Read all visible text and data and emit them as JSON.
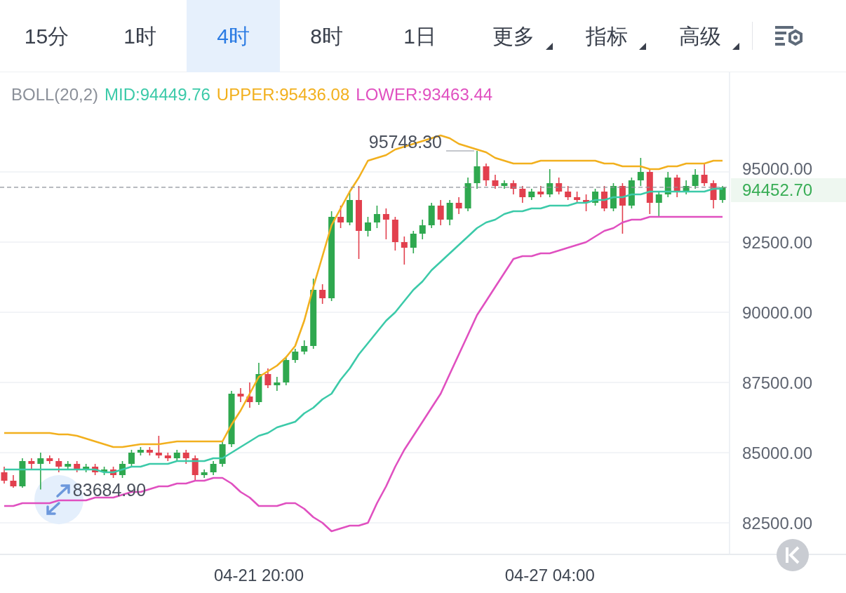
{
  "tabs": [
    {
      "label": "15分",
      "kind": "period",
      "selected": false
    },
    {
      "label": "1时",
      "kind": "period",
      "selected": false
    },
    {
      "label": "4时",
      "kind": "period",
      "selected": true
    },
    {
      "label": "8时",
      "kind": "period",
      "selected": false
    },
    {
      "label": "1日",
      "kind": "period",
      "selected": false
    },
    {
      "label": "更多",
      "kind": "dropdown",
      "selected": false
    },
    {
      "label": "指标",
      "kind": "dropdown",
      "selected": false
    },
    {
      "label": "高级",
      "kind": "dropdown",
      "selected": false
    }
  ],
  "indicator_legend": [
    {
      "text": "BOLL(20,2)",
      "color": "#8b9099"
    },
    {
      "text": "MID:94449.76",
      "color": "#3ccaa9"
    },
    {
      "text": "UPPER:95436.08",
      "color": "#f2b01e"
    },
    {
      "text": "LOWER:93463.44",
      "color": "#e050c0"
    }
  ],
  "chart": {
    "chart_data": {
      "type": "candlestick",
      "categories": [
        null,
        null,
        null,
        null,
        null,
        null,
        null,
        null,
        null,
        null,
        null,
        null,
        null,
        null,
        null,
        null,
        null,
        null,
        null,
        null,
        null,
        null,
        null,
        null,
        null,
        null,
        null,
        null,
        "04-21 20:00",
        null,
        null,
        null,
        null,
        null,
        null,
        null,
        null,
        null,
        null,
        null,
        null,
        null,
        null,
        null,
        null,
        null,
        null,
        null,
        null,
        null,
        null,
        null,
        null,
        null,
        null,
        null,
        null,
        null,
        null,
        null,
        "04-27 04:00",
        null,
        null,
        null,
        null,
        null,
        null,
        null,
        null,
        null,
        null,
        null,
        null,
        null,
        null,
        null,
        null,
        null,
        null,
        null
      ],
      "ohlc": [
        [
          84300,
          84500,
          83900,
          84000
        ],
        [
          84000,
          84200,
          83750,
          83800
        ],
        [
          83800,
          84800,
          83750,
          84700
        ],
        [
          84700,
          84800,
          84400,
          84600
        ],
        [
          84600,
          85000,
          83684.9,
          84800
        ],
        [
          84800,
          84900,
          84600,
          84700
        ],
        [
          84700,
          84800,
          84300,
          84500
        ],
        [
          84500,
          84700,
          84400,
          84600
        ],
        [
          84600,
          84700,
          84300,
          84400
        ],
        [
          84400,
          84600,
          84300,
          84500
        ],
        [
          84500,
          84600,
          84200,
          84300
        ],
        [
          84300,
          84500,
          84200,
          84400
        ],
        [
          84400,
          84500,
          84100,
          84200
        ],
        [
          84200,
          84700,
          84100,
          84600
        ],
        [
          84600,
          85100,
          84500,
          85000
        ],
        [
          85000,
          85200,
          84900,
          85100
        ],
        [
          85100,
          85200,
          84900,
          85000
        ],
        [
          85000,
          85600,
          84800,
          84900
        ],
        [
          84900,
          85000,
          84700,
          84800
        ],
        [
          84800,
          85100,
          84700,
          85000
        ],
        [
          85000,
          85100,
          84600,
          84800
        ],
        [
          84800,
          84900,
          84000,
          84200
        ],
        [
          84200,
          84400,
          84100,
          84300
        ],
        [
          84300,
          84700,
          84200,
          84600
        ],
        [
          84600,
          85400,
          84500,
          85300
        ],
        [
          85300,
          87200,
          85200,
          87100
        ],
        [
          87100,
          87300,
          86800,
          87000
        ],
        [
          87000,
          87500,
          86600,
          86800
        ],
        [
          86800,
          88200,
          86700,
          87800
        ],
        [
          87800,
          88000,
          87300,
          87400
        ],
        [
          87400,
          87700,
          87200,
          87500
        ],
        [
          87500,
          88400,
          87400,
          88300
        ],
        [
          88300,
          88700,
          88200,
          88600
        ],
        [
          88600,
          89000,
          88500,
          88800
        ],
        [
          88800,
          91200,
          88700,
          90800
        ],
        [
          90800,
          91000,
          90300,
          90500
        ],
        [
          90500,
          93600,
          90400,
          93400
        ],
        [
          93400,
          93800,
          93000,
          93200
        ],
        [
          93200,
          94300,
          93100,
          94000
        ],
        [
          94000,
          94500,
          91900,
          92900
        ],
        [
          92900,
          93400,
          92700,
          93200
        ],
        [
          93200,
          93800,
          93000,
          93500
        ],
        [
          93500,
          93700,
          92600,
          93300
        ],
        [
          93300,
          93400,
          92200,
          92500
        ],
        [
          92500,
          92700,
          91700,
          92300
        ],
        [
          92300,
          92900,
          92100,
          92800
        ],
        [
          92800,
          93300,
          92600,
          93100
        ],
        [
          93100,
          93900,
          93000,
          93800
        ],
        [
          93800,
          94000,
          93100,
          93300
        ],
        [
          93300,
          94000,
          93100,
          93900
        ],
        [
          93900,
          94100,
          93500,
          93700
        ],
        [
          93700,
          94800,
          93600,
          94600
        ],
        [
          94600,
          95748.3,
          94400,
          95200
        ],
        [
          95200,
          95300,
          94500,
          94700
        ],
        [
          94700,
          94900,
          94400,
          94500
        ],
        [
          94500,
          94700,
          94400,
          94600
        ],
        [
          94600,
          94700,
          94200,
          94400
        ],
        [
          94400,
          94500,
          93900,
          94100
        ],
        [
          94100,
          94400,
          94000,
          94300
        ],
        [
          94300,
          94500,
          94100,
          94200
        ],
        [
          94200,
          95100,
          94100,
          94600
        ],
        [
          94600,
          94800,
          94200,
          94300
        ],
        [
          94300,
          94500,
          94000,
          94100
        ],
        [
          94100,
          94300,
          93900,
          94000
        ],
        [
          94000,
          94200,
          93600,
          93900
        ],
        [
          93900,
          94400,
          93800,
          94300
        ],
        [
          94300,
          94500,
          93600,
          93700
        ],
        [
          93700,
          94600,
          93600,
          94500
        ],
        [
          94500,
          94600,
          92800,
          93800
        ],
        [
          93800,
          94800,
          93700,
          94700
        ],
        [
          94700,
          95500,
          94500,
          95000
        ],
        [
          95000,
          95100,
          93500,
          93900
        ],
        [
          93900,
          94300,
          93400,
          94200
        ],
        [
          94200,
          95000,
          94100,
          94800
        ],
        [
          94800,
          94900,
          94100,
          94300
        ],
        [
          94300,
          94700,
          94200,
          94500
        ],
        [
          94500,
          95100,
          94400,
          94900
        ],
        [
          94900,
          95300,
          94500,
          94600
        ],
        [
          94600,
          94700,
          93700,
          94000
        ],
        [
          94000,
          94500,
          93900,
          94450
        ]
      ],
      "series": [
        {
          "type": "line",
          "color": "#f2b01e",
          "values": [
            85700,
            85700,
            85700,
            85700,
            85700,
            85700,
            85650,
            85650,
            85600,
            85500,
            85400,
            85300,
            85200,
            85200,
            85250,
            85300,
            85300,
            85300,
            85350,
            85400,
            85400,
            85400,
            85400,
            85400,
            85400,
            86000,
            86500,
            87100,
            87700,
            87900,
            88100,
            88400,
            88800,
            89700,
            90900,
            92000,
            93100,
            93700,
            94300,
            94800,
            95400,
            95500,
            95600,
            95800,
            95900,
            96000,
            96100,
            96200,
            96300,
            96200,
            96000,
            95900,
            95800,
            95700,
            95500,
            95400,
            95300,
            95300,
            95300,
            95400,
            95400,
            95400,
            95400,
            95400,
            95400,
            95400,
            95300,
            95300,
            95200,
            95200,
            95200,
            95100,
            95100,
            95200,
            95200,
            95300,
            95300,
            95300,
            95400,
            95400
          ]
        },
        {
          "type": "line",
          "color": "#3ccaa9",
          "values": [
            84400,
            84400,
            84400,
            84400,
            84400,
            84400,
            84400,
            84400,
            84400,
            84400,
            84400,
            84300,
            84300,
            84400,
            84500,
            84500,
            84600,
            84600,
            84600,
            84700,
            84700,
            84700,
            84700,
            84800,
            84800,
            85000,
            85200,
            85400,
            85600,
            85700,
            85900,
            86000,
            86100,
            86400,
            86600,
            86900,
            87100,
            87600,
            88000,
            88500,
            88900,
            89300,
            89700,
            90000,
            90400,
            90800,
            91100,
            91500,
            91800,
            92100,
            92400,
            92700,
            93000,
            93200,
            93300,
            93500,
            93600,
            93600,
            93700,
            93700,
            93800,
            93800,
            93800,
            93900,
            93900,
            94000,
            94000,
            94100,
            94100,
            94200,
            94200,
            94300,
            94300,
            94300,
            94300,
            94300,
            94300,
            94300,
            94400,
            94400
          ]
        },
        {
          "type": "line",
          "color": "#e050c0",
          "values": [
            83100,
            83100,
            83200,
            83200,
            83200,
            83200,
            83300,
            83300,
            83300,
            83300,
            83400,
            83400,
            83400,
            83500,
            83600,
            83600,
            83700,
            83800,
            83800,
            83900,
            83900,
            84000,
            84000,
            84100,
            84100,
            83900,
            83600,
            83400,
            83100,
            83100,
            83100,
            83200,
            83200,
            83000,
            82700,
            82500,
            82200,
            82300,
            82400,
            82400,
            82500,
            83200,
            83800,
            84500,
            85100,
            85600,
            86100,
            86600,
            87100,
            87800,
            88500,
            89200,
            89900,
            90400,
            90900,
            91400,
            91900,
            92000,
            92000,
            92100,
            92100,
            92200,
            92300,
            92400,
            92500,
            92700,
            92900,
            93000,
            93200,
            93300,
            93300,
            93400,
            93400,
            93400,
            93400,
            93400,
            93400,
            93400,
            93400,
            93400
          ]
        }
      ],
      "ylim": [
        81375,
        98550
      ],
      "yticks": [
        {
          "value": 82500,
          "label": "82500.00"
        },
        {
          "value": 85000,
          "label": "85000.00"
        },
        {
          "value": 87500,
          "label": "87500.00"
        },
        {
          "value": 90000,
          "label": "90000.00"
        },
        {
          "value": 92500,
          "label": "92500.00"
        },
        {
          "value": 95000,
          "label": "95000.00"
        }
      ],
      "grid": true,
      "ref_lines": [
        {
          "axis": "y",
          "value": 94452.7,
          "label": "94452.70"
        }
      ],
      "annotations": [
        "95748.30",
        "83684.90"
      ]
    }
  }
}
